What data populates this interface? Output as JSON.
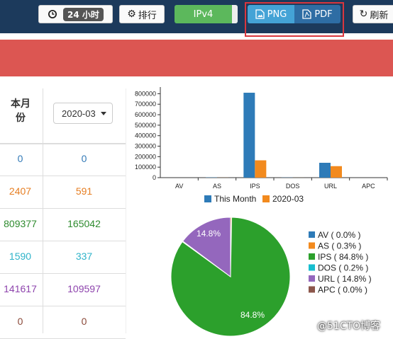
{
  "toolbar": {
    "time_badge": "24 小时",
    "rank_label": "排行",
    "ipv4_label": "IPv4",
    "png_label": "PNG",
    "pdf_label": "PDF",
    "refresh_label": "刷新"
  },
  "table": {
    "header_col1": "本月份",
    "month_select": "2020-03",
    "rows": [
      {
        "c1": "0",
        "c2": "0",
        "color": "#337ab7"
      },
      {
        "c1": "2407",
        "c2": "591",
        "color": "#e67e22"
      },
      {
        "c1": "809377",
        "c2": "165042",
        "color": "#2e8b2e"
      },
      {
        "c1": "1590",
        "c2": "337",
        "color": "#2eb3c9"
      },
      {
        "c1": "141617",
        "c2": "109597",
        "color": "#8e44ad"
      },
      {
        "c1": "0",
        "c2": "0",
        "color": "#8b4a3a"
      }
    ]
  },
  "chart_data": [
    {
      "type": "bar",
      "categories": [
        "AV",
        "AS",
        "IPS",
        "DOS",
        "URL",
        "APC"
      ],
      "series": [
        {
          "name": "This Month",
          "color": "#2e7bb8",
          "values": [
            0,
            2407,
            809377,
            1590,
            141617,
            0
          ]
        },
        {
          "name": "2020-03",
          "color": "#f28a1e",
          "values": [
            0,
            591,
            165042,
            337,
            109597,
            0
          ]
        }
      ],
      "yticks": [
        0,
        100000,
        200000,
        300000,
        400000,
        500000,
        600000,
        700000,
        800000
      ],
      "ylim": [
        0,
        850000
      ],
      "legend": "bottom"
    },
    {
      "type": "pie",
      "slices": [
        {
          "label": "AV ( 0.0% )",
          "value": 0.0,
          "color": "#2e7bb8"
        },
        {
          "label": "AS ( 0.3% )",
          "value": 0.3,
          "color": "#f28a1e"
        },
        {
          "label": "IPS ( 84.8% )",
          "value": 84.8,
          "color": "#2ca02c"
        },
        {
          "label": "DOS ( 0.2% )",
          "value": 0.2,
          "color": "#17becf"
        },
        {
          "label": "URL ( 14.8% )",
          "value": 14.8,
          "color": "#9467bd"
        },
        {
          "label": "APC ( 0.0% )",
          "value": 0.0,
          "color": "#8c564b"
        }
      ],
      "slice_labels": [
        "84.8%",
        "14.8%"
      ],
      "legend": "right"
    }
  ],
  "watermark": "@51CTO博客"
}
